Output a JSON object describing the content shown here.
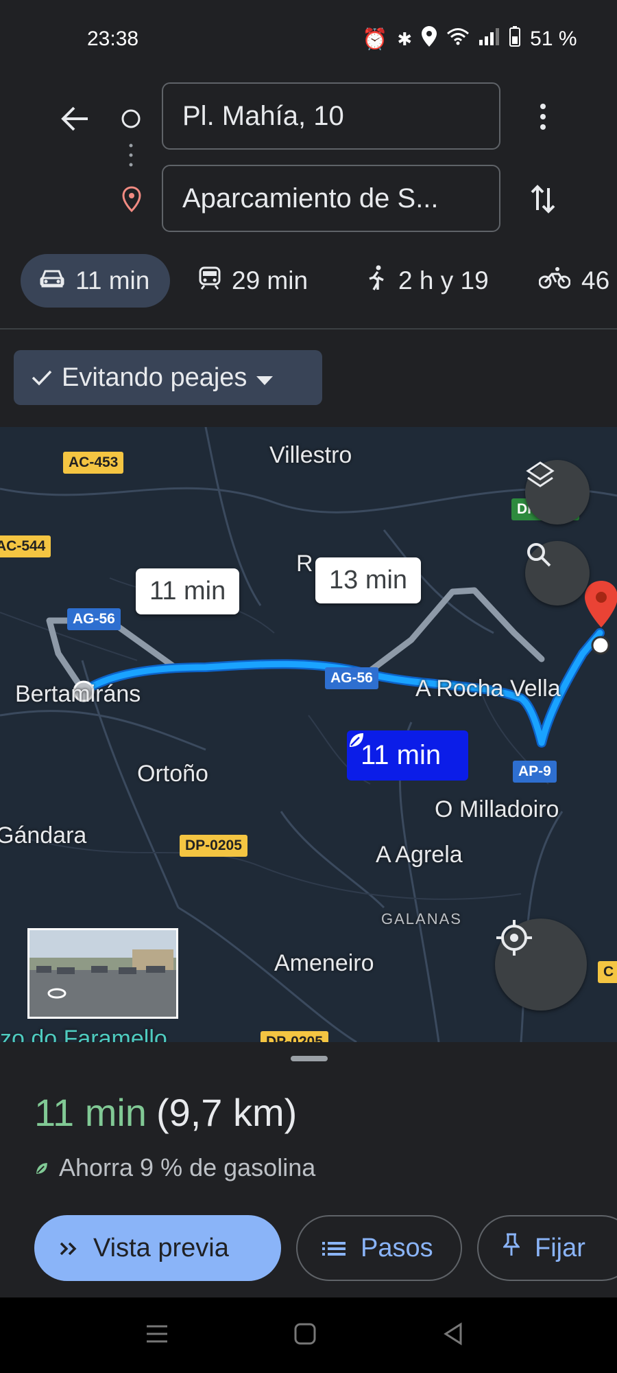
{
  "status_bar": {
    "time": "23:38",
    "battery": "51 %"
  },
  "header": {
    "origin": "Pl. Mahía, 10",
    "destination": "Aparcamiento de S..."
  },
  "modes": [
    {
      "name": "car",
      "time": "11 min",
      "selected": true
    },
    {
      "name": "transit",
      "time": "29 min"
    },
    {
      "name": "walk",
      "time": "2 h y 19"
    },
    {
      "name": "bike",
      "time": "46"
    }
  ],
  "filter_chip": {
    "label": "Evitando peajes"
  },
  "map": {
    "places": [
      "Villestro",
      "Bertamiráns",
      "Ortoño",
      "Gándara",
      "A Rocha Vella",
      "O Milladoiro",
      "A Agrela",
      "GALANAS",
      "Ameneiro",
      "R",
      "zo do Faramello"
    ],
    "roads": [
      "AC-453",
      "AC-544",
      "AG-56",
      "AG-56",
      "AP-9",
      "DP-0205",
      "DP-3803",
      "DP-0205",
      "C"
    ],
    "bubbles": {
      "alt1": "11 min",
      "alt2": "13 min",
      "selected": "11 min"
    }
  },
  "sheet": {
    "time": "11 min",
    "distance": "(9,7 km)",
    "fuel_note": "Ahorra 9 % de gasolina",
    "preview_label": "Vista previa",
    "steps_label": "Pasos",
    "pin_label": "Fijar"
  },
  "colors": {
    "accent": "#8ab4f8",
    "eta_green": "#81c995",
    "route": "#1aa3ff",
    "selected_bubble": "#0b1de8"
  }
}
